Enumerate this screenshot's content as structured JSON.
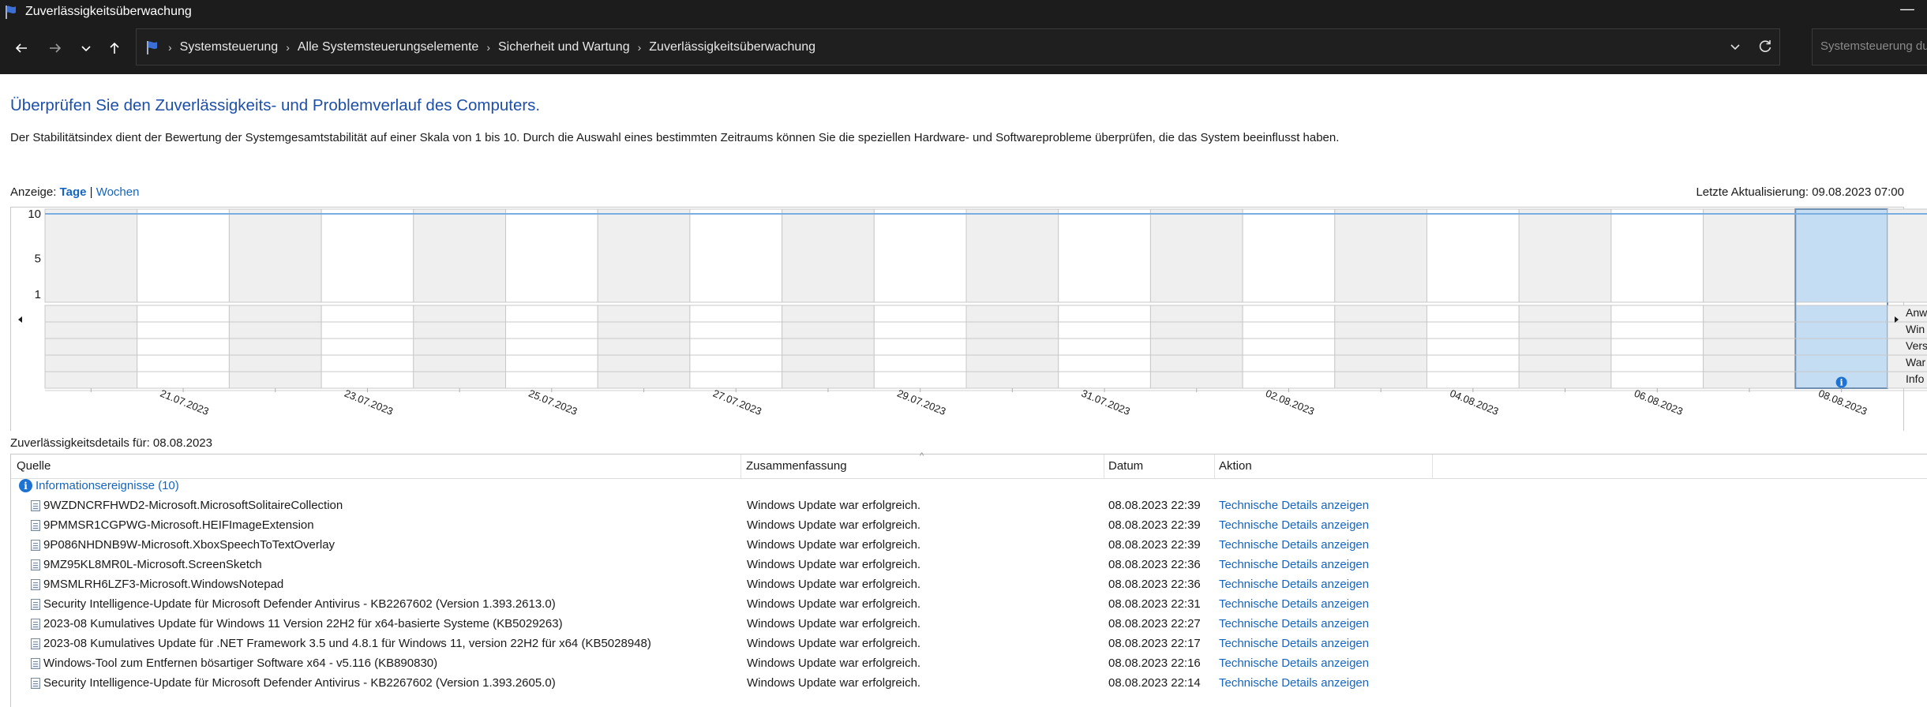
{
  "window": {
    "title": "Zuverlässigkeitsüberwachung"
  },
  "address_bar": {
    "breadcrumbs": [
      "Systemsteuerung",
      "Alle Systemsteuerungselemente",
      "Sicherheit und Wartung",
      "Zuverlässigkeitsüberwachung"
    ],
    "search_placeholder": "Systemsteuerung durchsuchen"
  },
  "page": {
    "heading": "Überprüfen Sie den Zuverlässigkeits- und Problemverlauf des Computers.",
    "description": "Der Stabilitätsindex dient der Bewertung der Systemgesamtstabilität auf einer Skala von 1 bis 10. Durch die Auswahl eines bestimmten Zeitraums können Sie die speziellen Hardware- und Softwareprobleme überprüfen, die das System beeinflusst haben.",
    "view_label": "Anzeige:",
    "view_days": "Tage",
    "view_separator": "|",
    "view_weeks": "Wochen",
    "last_update": "Letzte Aktualisierung: 09.08.2023 07:00"
  },
  "chart_data": {
    "type": "line",
    "y_ticks": [
      "10",
      "5",
      "1"
    ],
    "ylim": [
      1,
      10
    ],
    "x_labels": [
      "21.07.2023",
      "23.07.2023",
      "25.07.2023",
      "27.07.2023",
      "29.07.2023",
      "31.07.2023",
      "02.08.2023",
      "04.08.2023",
      "06.08.2023",
      "08.08.2023"
    ],
    "days": [
      "20.07.2023",
      "21.07.2023",
      "22.07.2023",
      "23.07.2023",
      "24.07.2023",
      "25.07.2023",
      "26.07.2023",
      "27.07.2023",
      "28.07.2023",
      "29.07.2023",
      "30.07.2023",
      "31.07.2023",
      "01.08.2023",
      "02.08.2023",
      "03.08.2023",
      "04.08.2023",
      "05.08.2023",
      "06.08.2023",
      "07.08.2023",
      "08.08.2023",
      "09.08.2023"
    ],
    "stability_index": [
      10,
      10,
      10,
      10,
      10,
      10,
      10,
      10,
      10,
      10,
      10,
      10,
      10,
      10,
      10,
      10,
      10,
      10,
      10,
      10,
      10
    ],
    "selected_day": "08.08.2023",
    "event_rows": [
      "Anwendungsfehler",
      "Windows-Fehler",
      "Verschiedene Fehler",
      "Warnungen",
      "Informationen"
    ],
    "event_row_visible_labels": [
      "Anw",
      "Win",
      "Vers",
      "War",
      "Info"
    ],
    "events": [
      {
        "day": "08.08.2023",
        "row": "Informationen",
        "icon": "info-icon"
      }
    ],
    "grid": true,
    "colors": {
      "shaded": "#efefef",
      "selected": "#c4ddf3",
      "grid": "#c8c8c8",
      "line": "#7aaee0"
    }
  },
  "details": {
    "title": "Zuverlässigkeitsdetails für: 08.08.2023",
    "columns": [
      "Quelle",
      "Zusammenfassung",
      "Datum",
      "Aktion"
    ],
    "group_label": "Informationsereignisse (10)",
    "rows": [
      {
        "source": "9WZDNCRFHWD2-Microsoft.MicrosoftSolitaireCollection",
        "summary": "Windows Update war erfolgreich.",
        "date": "08.08.2023 22:39",
        "action": "Technische Details anzeigen"
      },
      {
        "source": "9PMMSR1CGPWG-Microsoft.HEIFImageExtension",
        "summary": "Windows Update war erfolgreich.",
        "date": "08.08.2023 22:39",
        "action": "Technische Details anzeigen"
      },
      {
        "source": "9P086NHDNB9W-Microsoft.XboxSpeechToTextOverlay",
        "summary": "Windows Update war erfolgreich.",
        "date": "08.08.2023 22:39",
        "action": "Technische Details anzeigen"
      },
      {
        "source": "9MZ95KL8MR0L-Microsoft.ScreenSketch",
        "summary": "Windows Update war erfolgreich.",
        "date": "08.08.2023 22:36",
        "action": "Technische Details anzeigen"
      },
      {
        "source": "9MSMLRH6LZF3-Microsoft.WindowsNotepad",
        "summary": "Windows Update war erfolgreich.",
        "date": "08.08.2023 22:36",
        "action": "Technische Details anzeigen"
      },
      {
        "source": "Security Intelligence-Update für Microsoft Defender Antivirus - KB2267602 (Version 1.393.2613.0)",
        "summary": "Windows Update war erfolgreich.",
        "date": "08.08.2023 22:31",
        "action": "Technische Details anzeigen"
      },
      {
        "source": "2023-08 Kumulatives Update für Windows 11 Version 22H2 für x64-basierte Systeme (KB5029263)",
        "summary": "Windows Update war erfolgreich.",
        "date": "08.08.2023 22:27",
        "action": "Technische Details anzeigen"
      },
      {
        "source": "2023-08 Kumulatives Update für .NET Framework 3.5 und 4.8.1 für Windows 11, version 22H2 für x64 (KB5028948)",
        "summary": "Windows Update war erfolgreich.",
        "date": "08.08.2023 22:17",
        "action": "Technische Details anzeigen"
      },
      {
        "source": "Windows-Tool zum Entfernen bösartiger Software x64 - v5.116 (KB890830)",
        "summary": "Windows Update war erfolgreich.",
        "date": "08.08.2023 22:16",
        "action": "Technische Details anzeigen"
      },
      {
        "source": "Security Intelligence-Update für Microsoft Defender Antivirus - KB2267602 (Version 1.393.2605.0)",
        "summary": "Windows Update war erfolgreich.",
        "date": "08.08.2023 22:14",
        "action": "Technische Details anzeigen"
      }
    ]
  }
}
